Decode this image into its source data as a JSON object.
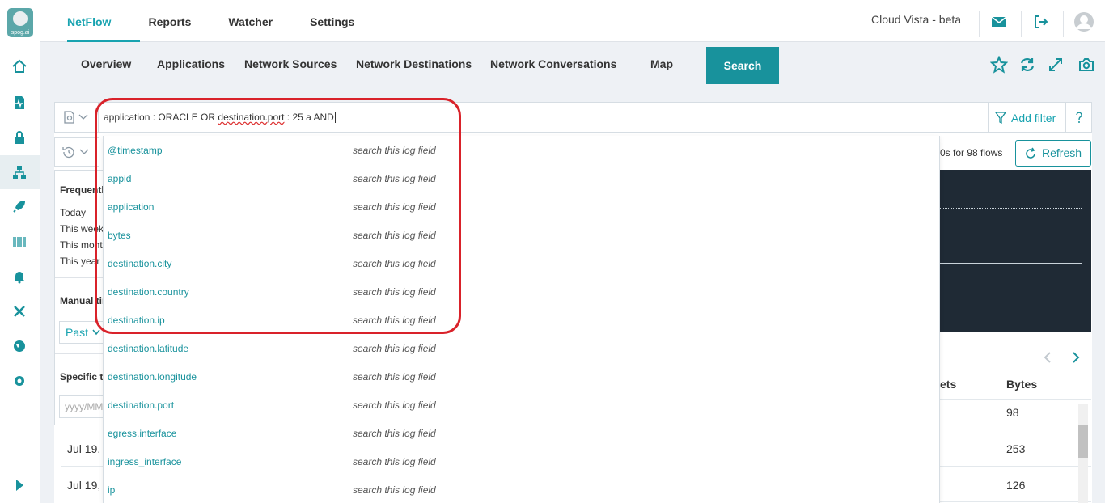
{
  "app": {
    "logo_text": "spog.ai",
    "brand": "Cloud Vista - beta"
  },
  "topnav": [
    {
      "label": "NetFlow",
      "active": true
    },
    {
      "label": "Reports"
    },
    {
      "label": "Watcher"
    },
    {
      "label": "Settings"
    }
  ],
  "subnav": {
    "overview": "Overview",
    "applications": "Applications",
    "network_sources": "Network Sources",
    "network_destinations": "Network Destinations",
    "network_conversations": "Network Conversations",
    "map": "Map",
    "search": "Search"
  },
  "search": {
    "query_prefix": "application : ORACLE OR ",
    "query_underlined": "destination.port",
    "query_suffix": " : 25 a AND",
    "add_filter": "Add filter"
  },
  "status": {
    "flows_text": "0s for 98 flows",
    "refresh": "Refresh"
  },
  "time_panel": {
    "frequently": "Frequently",
    "today": "Today",
    "this_week": "This week",
    "this_month": "This month",
    "this_year": "This year",
    "manual": "Manual time",
    "past": "Past",
    "specific": "Specific time",
    "date_placeholder": "yyyy/MM/dd"
  },
  "table": {
    "col_packets": "ets",
    "col_bytes": "Bytes",
    "bytes": [
      "98",
      "253",
      "126"
    ],
    "dates": [
      "Jul 19,",
      "Jul 19,"
    ]
  },
  "dropdown": {
    "hint": "search this log field",
    "fields": [
      "@timestamp",
      "appid",
      "application",
      "bytes",
      "destination.city",
      "destination.country",
      "destination.ip",
      "destination.latitude",
      "destination.longitude",
      "destination.port",
      "egress.interface",
      "ingress_interface",
      "ip"
    ]
  },
  "colors": {
    "accent": "#18a3b0",
    "search_tab": "#18929c",
    "highlight": "#d9222a"
  }
}
